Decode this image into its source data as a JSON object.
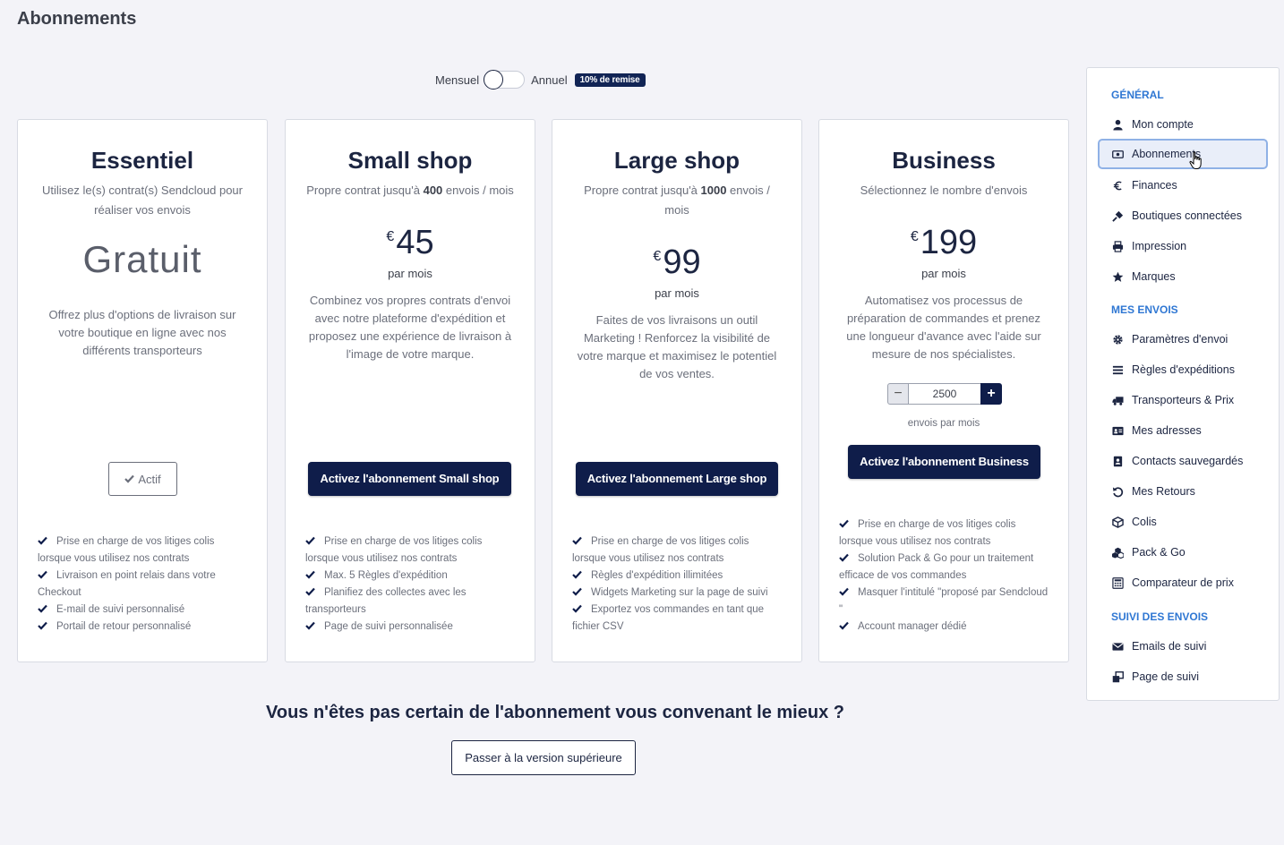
{
  "page_title": "Abonnements",
  "billing": {
    "monthly_label": "Mensuel",
    "yearly_label": "Annuel",
    "discount_badge": "10% de remise",
    "yearly_selected": false
  },
  "plans": [
    {
      "title": "Essentiel",
      "subtitle": "Utilisez le(s) contrat(s) Sendcloud pour réaliser vos envois",
      "price_text": "Gratuit",
      "description": "Offrez plus d'options de livraison sur votre boutique en ligne avec nos différents transporteurs",
      "button": "Actif",
      "features": [
        "Prise en charge de vos litiges colis lorsque vous utilisez nos contrats",
        "Livraison en point relais dans votre Checkout",
        "E-mail de suivi personnalisé",
        "Portail de retour personnalisé"
      ]
    },
    {
      "title": "Small shop",
      "subtitle_pre": "Propre contrat jusqu'à ",
      "subtitle_num": "400",
      "subtitle_post": " envois / mois",
      "currency": "€",
      "amount": "45",
      "per": "par mois",
      "description": "Combinez vos propres contrats d'envoi avec notre plateforme d'expédition et proposez une expérience de livraison à l'image de votre marque.",
      "button": "Activez l'abonnement Small shop",
      "features": [
        "Prise en charge de vos litiges colis lorsque vous utilisez nos contrats",
        "Max. 5 Règles d'expédition",
        "Planifiez des collectes avec les transporteurs",
        "Page de suivi personnalisée"
      ]
    },
    {
      "title": "Large shop",
      "subtitle_pre": "Propre contrat jusqu'à ",
      "subtitle_num": "1000",
      "subtitle_post": " envois / mois",
      "currency": "€",
      "amount": "99",
      "per": "par mois",
      "description": "Faites de vos livraisons un outil Marketing ! Renforcez la visibilité de votre marque et maximisez le potentiel de vos ventes.",
      "button": "Activez l'abonnement Large shop",
      "features": [
        "Prise en charge de vos litiges colis lorsque vous utilisez nos contrats",
        "Règles d'expédition illimitées",
        "Widgets Marketing sur la page de suivi",
        "Exportez vos commandes en tant que fichier CSV"
      ]
    },
    {
      "title": "Business",
      "subtitle": "Sélectionnez le nombre d'envois",
      "currency": "€",
      "amount": "199",
      "per": "par mois",
      "description": "Automatisez vos processus de préparation de commandes et prenez une longueur d'avance avec l'aide sur mesure de nos spécialistes.",
      "stepper_minus": "−",
      "stepper_value": "2500",
      "stepper_plus": "+",
      "stepper_label": "envois par mois",
      "button": "Activez l'abonnement Business",
      "features": [
        "Prise en charge de vos litiges colis lorsque vous utilisez nos contrats",
        "Solution Pack & Go pour un traitement efficace de vos commandes",
        "Masquer l'intitulé \"proposé par Sendcloud \"",
        "Account manager dédié"
      ]
    }
  ],
  "bottom": {
    "question": "Vous n'êtes pas certain de l'abonnement vous convenant le mieux ?",
    "button": "Passer à la version supérieure"
  },
  "sidebar": {
    "sections": [
      {
        "title": "GÉNÉRAL",
        "items": [
          {
            "label": "Mon compte",
            "icon": "user-icon"
          },
          {
            "label": "Abonnements",
            "icon": "money-icon",
            "active": true
          },
          {
            "label": "Finances",
            "icon": "euro-icon"
          },
          {
            "label": "Boutiques connectées",
            "icon": "plug-icon"
          },
          {
            "label": "Impression",
            "icon": "printer-icon"
          },
          {
            "label": "Marques",
            "icon": "star-icon"
          }
        ]
      },
      {
        "title": "MES ENVOIS",
        "items": [
          {
            "label": "Paramètres d'envoi",
            "icon": "gear-icon"
          },
          {
            "label": "Règles d'expéditions",
            "icon": "list-icon"
          },
          {
            "label": "Transporteurs & Prix",
            "icon": "truck-icon"
          },
          {
            "label": "Mes adresses",
            "icon": "address-card-icon"
          },
          {
            "label": "Contacts sauvegardés",
            "icon": "contact-book-icon"
          },
          {
            "label": "Mes Retours",
            "icon": "return-icon"
          },
          {
            "label": "Colis",
            "icon": "box-icon"
          },
          {
            "label": "Pack & Go",
            "icon": "boxes-icon"
          },
          {
            "label": "Comparateur de prix",
            "icon": "calculator-icon"
          }
        ]
      },
      {
        "title": "SUIVI DES ENVOIS",
        "items": [
          {
            "label": "Emails de suivi",
            "icon": "envelope-icon"
          },
          {
            "label": "Page de suivi",
            "icon": "external-window-icon"
          }
        ]
      }
    ]
  },
  "colors": {
    "primary": "#0f1d4a",
    "section_title": "#2f77d3",
    "background": "#f3f3f8"
  }
}
